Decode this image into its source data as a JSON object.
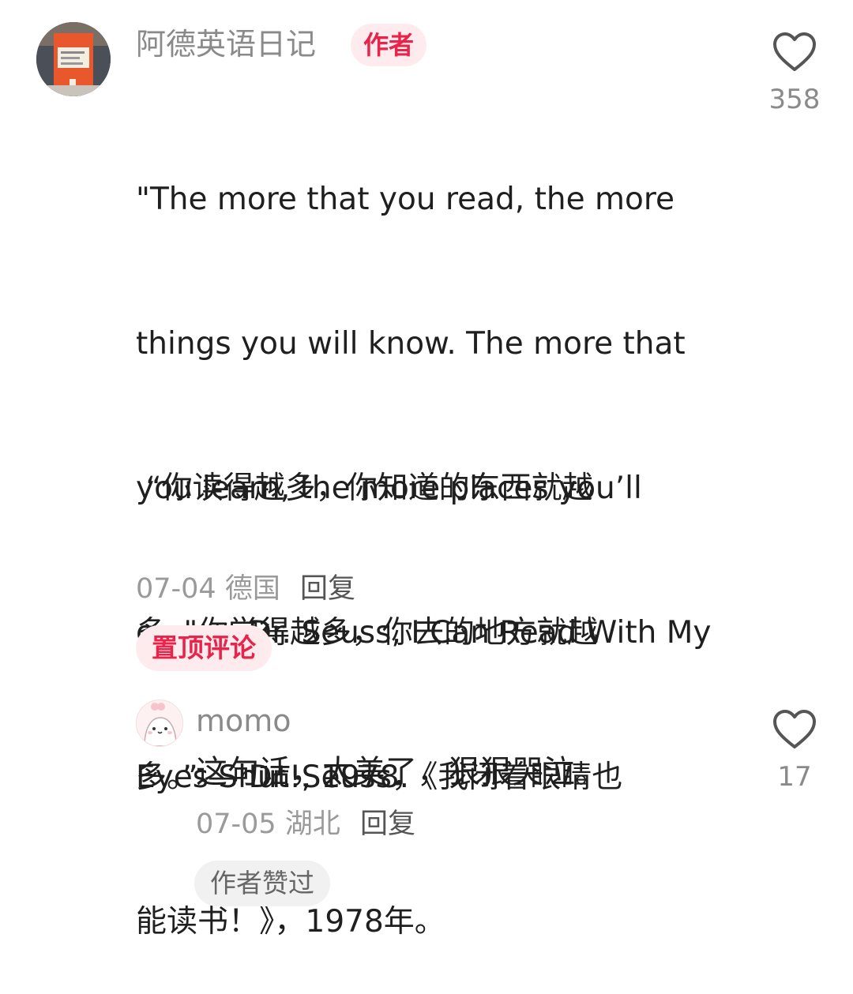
{
  "main_comment": {
    "username": "阿德英语日记",
    "author_badge": "作者",
    "english_lines": [
      "\"The more that you read, the more",
      "things you will know. The more that",
      "you learn, the more places you’ll",
      "go.\" — Dr. Seuss, I Can Read With My",
      "Eyes Shut!, 1978."
    ],
    "chinese_lines": [
      " “你读得越多，你知道的东西就越",
      "多。你学得越多，你去的地方就越",
      "多。” — Dr. Seuss，《我闭着眼睛也",
      "能读书！》，1978年。"
    ],
    "date": "07-04",
    "location": "德国",
    "reply_label": "回复",
    "pin_label": "置顶评论",
    "like_count": "358"
  },
  "reply_comment": {
    "username": "momo",
    "text": "这句话，太美了，狠狠哭泣。",
    "date": "07-05",
    "location": "湖北",
    "reply_label": "回复",
    "like_count": "17",
    "author_liked_label": "作者赞过"
  },
  "colors": {
    "accent": "#e8244a",
    "badge_bg": "#fdebee",
    "muted_text": "#8a8a8a"
  },
  "icons": {
    "like": "heart-outline-icon",
    "main_avatar": "book-avatar",
    "reply_avatar": "cartoon-avatar"
  }
}
